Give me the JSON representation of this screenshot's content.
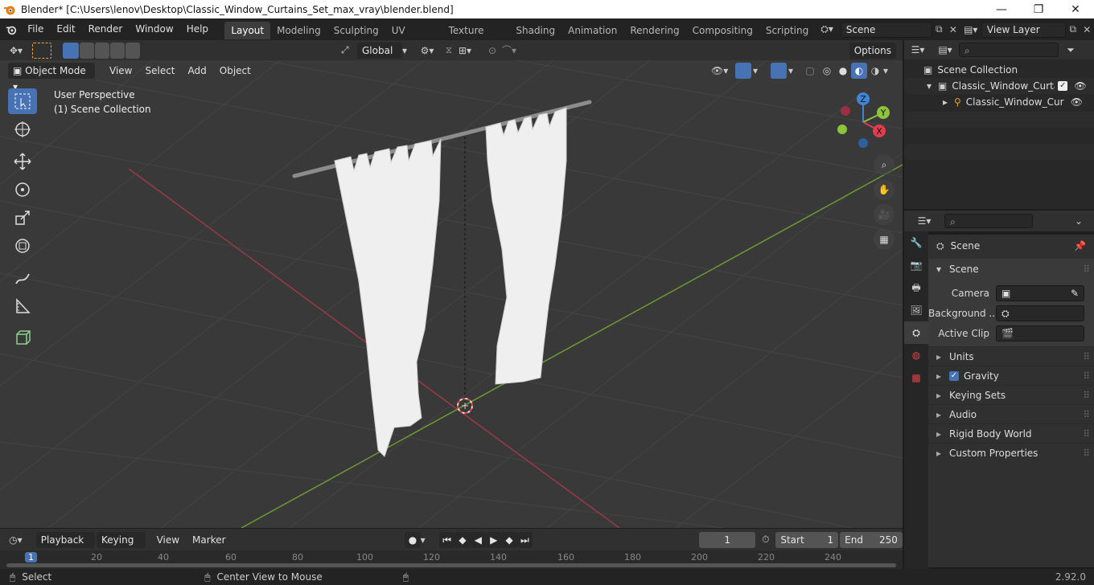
{
  "window": {
    "title": "Blender* [C:\\Users\\lenov\\Desktop\\Classic_Window_Curtains_Set_max_vray\\blender.blend]"
  },
  "menus": [
    "File",
    "Edit",
    "Render",
    "Window",
    "Help"
  ],
  "workspaces": [
    "Layout",
    "Modeling",
    "Sculpting",
    "UV Editing",
    "Texture Paint",
    "Shading",
    "Animation",
    "Rendering",
    "Compositing",
    "Scripting"
  ],
  "scene_field": "Scene",
  "view_layer_field": "View Layer",
  "viewport": {
    "mode": "Object Mode",
    "menus": [
      "View",
      "Select",
      "Add",
      "Object"
    ],
    "orientation": "Global",
    "options": "Options",
    "overlay_line1": "User Perspective",
    "overlay_line2": "(1) Scene Collection",
    "gizmo_labels": {
      "x": "X",
      "y": "Y",
      "z": "Z"
    }
  },
  "outliner": {
    "root": "Scene Collection",
    "collection": "Classic_Window_Curtain",
    "object": "Classic_Window_Cur"
  },
  "properties": {
    "context": "Scene",
    "panel": "Scene",
    "fields": [
      {
        "label": "Camera",
        "value": ""
      },
      {
        "label": "Background ...",
        "value": ""
      },
      {
        "label": "Active Clip",
        "value": ""
      }
    ],
    "sections": [
      "Units",
      "Gravity",
      "Keying Sets",
      "Audio",
      "Rigid Body World",
      "Custom Properties"
    ]
  },
  "timeline": {
    "menus": [
      "Playback",
      "Keying",
      "View",
      "Marker"
    ],
    "current_frame": "1",
    "start_label": "Start",
    "start": "1",
    "end_label": "End",
    "end": "250",
    "ruler": [
      "1",
      "20",
      "40",
      "60",
      "80",
      "100",
      "120",
      "140",
      "160",
      "180",
      "200",
      "220",
      "240"
    ]
  },
  "statusbar": {
    "left": "Select",
    "middle": "Center View to Mouse",
    "version": "2.92.0"
  },
  "colors": {
    "accent": "#4772b3",
    "x_axis": "#e33c4f",
    "y_axis": "#8cc43b",
    "z_axis": "#3f86d6",
    "viewport_bg": "#393939"
  }
}
